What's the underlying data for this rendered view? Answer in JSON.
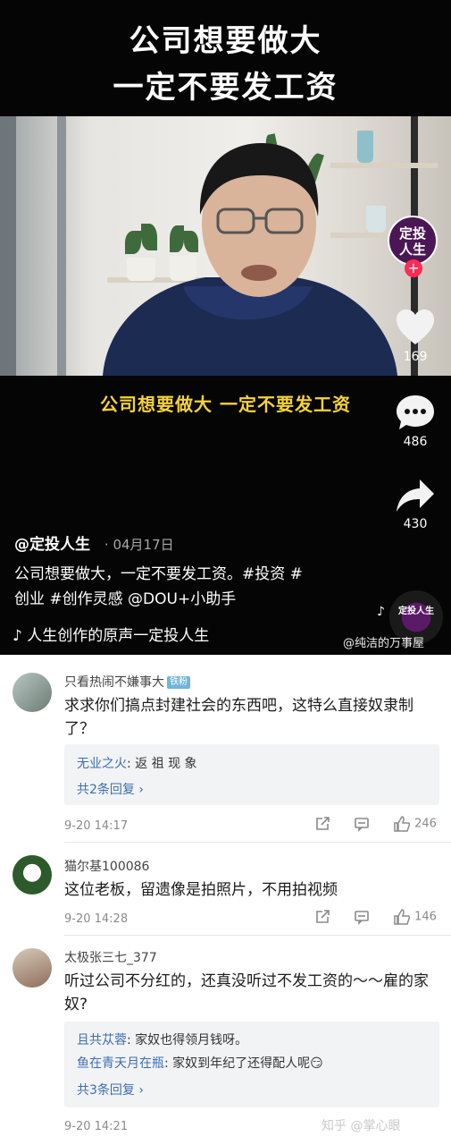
{
  "video": {
    "title_line1": "公司想要做大",
    "title_line2": "一定不要发工资",
    "subtitle": "公司想要做大 一定不要发工资",
    "avatar_badge_line1": "定投",
    "avatar_badge_line2": "人生",
    "like_count": "169",
    "comment_count": "486",
    "share_count": "430",
    "author": "@定投人生",
    "date": "· 04月17日",
    "description_line1": "公司想要做大，一定不要发工资。#投资 #",
    "description_line2": "创业 #创作灵感 @DOU+小助手",
    "music": "人生创作的原声一定投人生",
    "disc_label": "定投人生",
    "watermark": "@纯洁的万事屋",
    "icons": [
      "heart-icon",
      "comment-bubble-icon",
      "share-arrow-icon",
      "tiktok-note-icon",
      "music-note-icon"
    ]
  },
  "comments": [
    {
      "user": "只看热闹不嫌事大",
      "badge": "铁粉",
      "text": "求求你们搞点封建社会的东西吧，这特么直接奴隶制了？",
      "replies": [
        {
          "name": "无业之火",
          "text": ": 返 祖 现 象"
        }
      ],
      "more": "共2条回复 ›",
      "time": "9-20 14:17",
      "likes": "246"
    },
    {
      "user": "猫尔基100086",
      "text": "这位老板，留遗像是拍照片，不用拍视频",
      "time": "9-20 14:28",
      "likes": "146"
    },
    {
      "user": "太极张三七_377",
      "text": "听过公司不分红的，还真没听过不发工资的～～雇的家奴?",
      "replies": [
        {
          "name": "且共苁蓉",
          "text": ": 家奴也得领月钱呀。"
        },
        {
          "name": "鱼在青天月在瓶",
          "text": ": 家奴到年纪了还得配人呢😏"
        }
      ],
      "more": "共3条回复 ›",
      "time": "9-20 14:21",
      "likes": ""
    }
  ],
  "zhihu_watermark": "知乎 @掌心眼",
  "colors": {
    "subtitle": "#f5d23b",
    "reply_name": "#3d6fb0",
    "like_pink": "#fe2c55",
    "badge_purple": "#4a1754"
  }
}
